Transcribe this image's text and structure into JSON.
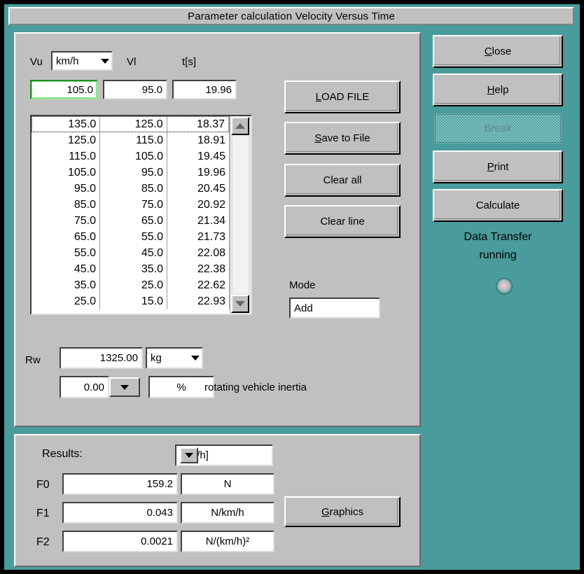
{
  "window": {
    "title": "Parameter calculation Velocity Versus Time"
  },
  "colors": {
    "teal_background": "#4a9b9b",
    "panel_face": "#c0c0c0",
    "field_background": "#ffffff",
    "focus_green": "#2a8a2a",
    "text": "#000000"
  },
  "inputs": {
    "vu_label": "Vu",
    "vu_unit_value": "km/h",
    "vu_value": "105.0",
    "vl_label": "Vl",
    "vl_value": "95.0",
    "t_label": "t[s]",
    "t_value": "19.96"
  },
  "list": {
    "columns": [
      "Vu",
      "Vl",
      "t"
    ],
    "selected_index": 0,
    "rows": [
      [
        "135.0",
        "125.0",
        "18.37"
      ],
      [
        "125.0",
        "115.0",
        "18.91"
      ],
      [
        "115.0",
        "105.0",
        "19.45"
      ],
      [
        "105.0",
        "95.0",
        "19.96"
      ],
      [
        "95.0",
        "85.0",
        "20.45"
      ],
      [
        "85.0",
        "75.0",
        "20.92"
      ],
      [
        "75.0",
        "65.0",
        "21.34"
      ],
      [
        "65.0",
        "55.0",
        "21.73"
      ],
      [
        "55.0",
        "45.0",
        "22.08"
      ],
      [
        "45.0",
        "35.0",
        "22.38"
      ],
      [
        "35.0",
        "25.0",
        "22.62"
      ],
      [
        "25.0",
        "15.0",
        "22.93"
      ]
    ]
  },
  "file_buttons": {
    "load_file": "LOAD FILE",
    "load_file_accel": "L",
    "save_to_file": "Save to File",
    "save_to_file_accel": "S",
    "clear_all": "Clear all",
    "clear_line": "Clear line"
  },
  "mode": {
    "label": "Mode",
    "value": "Add"
  },
  "mass": {
    "rw_label": "Rw",
    "rw_value": "1325.00",
    "rw_unit": "kg",
    "inertia_value": "0.00",
    "inertia_unit": "%",
    "inertia_label": "rotating vehicle inertia"
  },
  "side_buttons": {
    "close": "Close",
    "close_accel": "C",
    "help": "Help",
    "help_accel": "H",
    "break": "Break",
    "print": "Print",
    "print_accel": "P",
    "calculate": "Calculate"
  },
  "data_transfer": {
    "line1": "Data Transfer",
    "line2": "running",
    "indicator": "led-indicator"
  },
  "results": {
    "title": "Results:",
    "unit_select": "[km/h]",
    "rows": [
      {
        "label": "F0",
        "value": "159.2",
        "unit": "N"
      },
      {
        "label": "F1",
        "value": "0.043",
        "unit": "N/km/h"
      },
      {
        "label": "F2",
        "value": "0.0021",
        "unit": "N/(km/h)²"
      }
    ],
    "graphics_button": "Graphics",
    "graphics_accel": "G"
  }
}
